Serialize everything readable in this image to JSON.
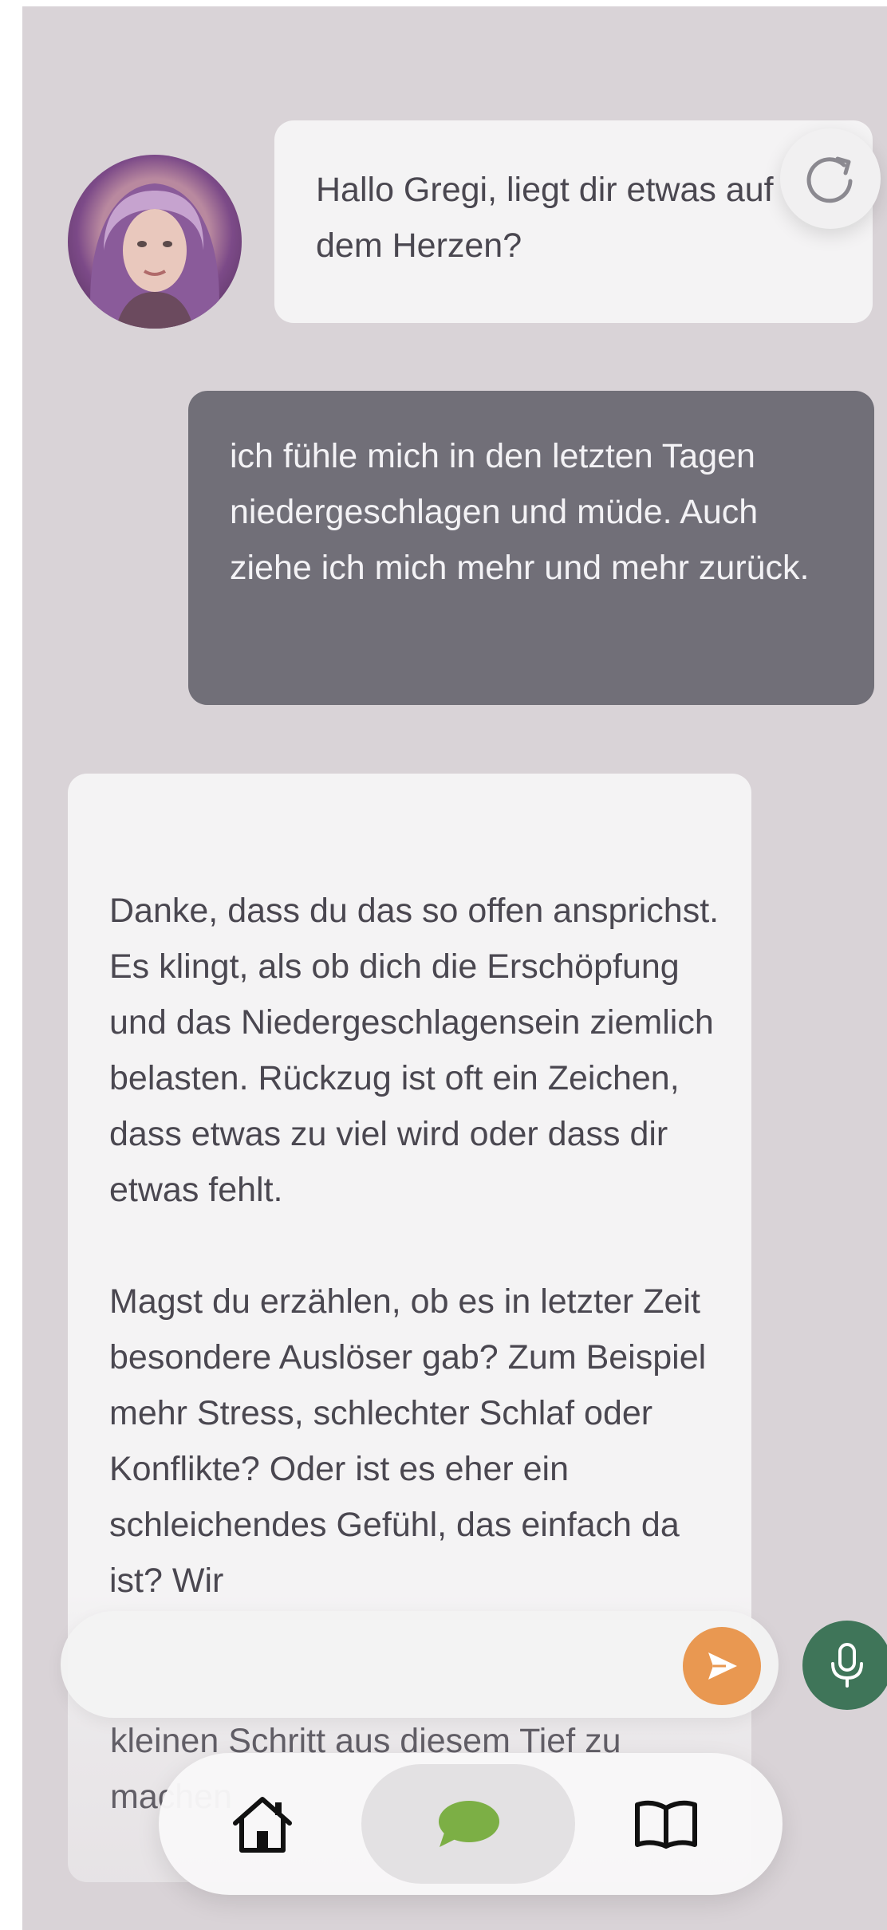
{
  "chat": {
    "messages": [
      {
        "role": "assistant",
        "text": "Hallo Gregi, liegt dir etwas auf dem Herzen?"
      },
      {
        "role": "user",
        "text": "ich fühle mich in den letzten Tagen niedergeschlagen und müde. Auch ziehe ich mich mehr und mehr zurück."
      },
      {
        "role": "assistant",
        "text": "Danke, dass du das so offen ansprichst. Es klingt, als ob dich die Erschöpfung und das Niedergeschlagensein ziemlich belasten. Rückzug ist oft ein Zeichen, dass etwas zu viel wird oder dass dir etwas fehlt.\n\nMagst du erzählen, ob es in letzter Zeit besondere Auslöser gab? Zum Beispiel mehr Stress, schlechter Schlaf oder Konflikte? Oder ist es eher ein schleichendes Gefühl, das einfach da ist? Wir"
      }
    ],
    "partial_tail": "kleinen Schritt aus diesem Tief zu machen"
  },
  "composer": {
    "placeholder": ""
  },
  "icons": {
    "refresh": "refresh-icon",
    "send": "send-icon",
    "mic": "microphone-icon",
    "home": "home-icon",
    "chat": "chat-bubble-icon",
    "book": "book-icon"
  },
  "colors": {
    "background": "#d9d3d7",
    "assistant_bubble": "#f4f3f4",
    "user_bubble": "#716f78",
    "send_accent": "#e99851",
    "mic_accent": "#3f7559",
    "chat_icon": "#7caf45"
  }
}
